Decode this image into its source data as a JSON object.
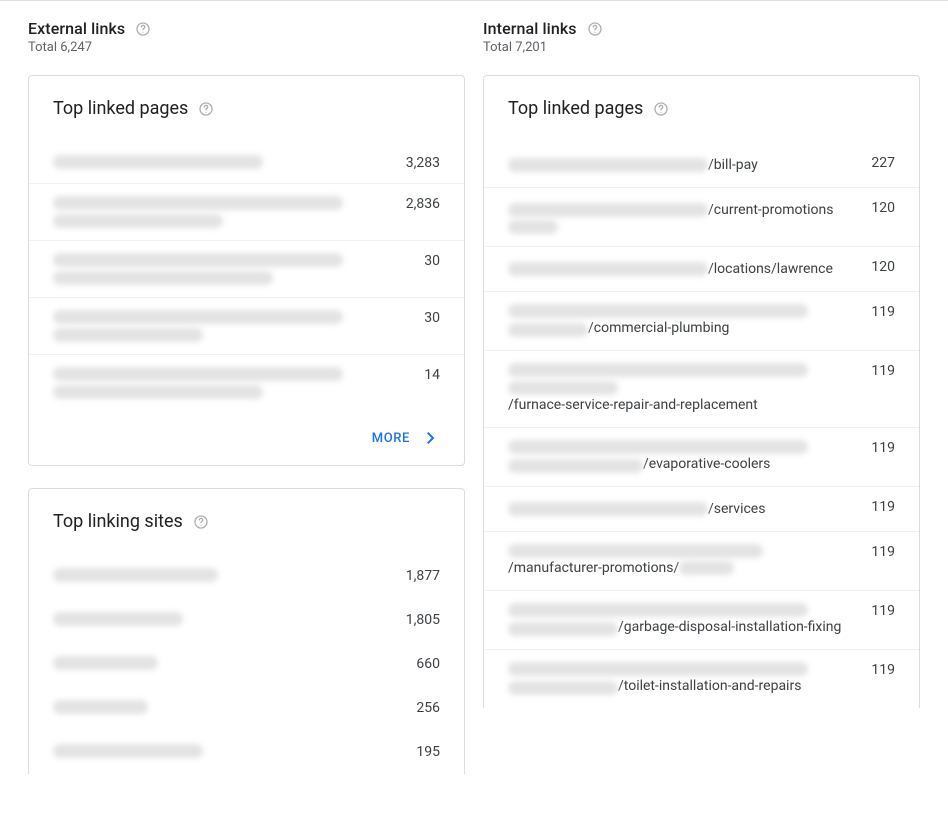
{
  "external": {
    "title": "External links",
    "subtitle": "Total 6,247",
    "top_pages": {
      "title": "Top linked pages",
      "more_label": "MORE",
      "rows": [
        {
          "blurs": [
            210
          ],
          "tail": "",
          "value": "3,283"
        },
        {
          "blurs": [
            290,
            170
          ],
          "tail": "",
          "value": "2,836"
        },
        {
          "blurs": [
            290,
            220
          ],
          "tail": "",
          "value": "30"
        },
        {
          "blurs": [
            290,
            150
          ],
          "tail": "",
          "value": "30"
        },
        {
          "blurs": [
            290,
            210
          ],
          "tail": "",
          "value": "14"
        }
      ]
    },
    "top_sites": {
      "title": "Top linking sites",
      "rows": [
        {
          "blurs": [
            165
          ],
          "tail": "",
          "value": "1,877"
        },
        {
          "blurs": [
            130
          ],
          "tail": "",
          "value": "1,805"
        },
        {
          "blurs": [
            105
          ],
          "tail": "",
          "value": "660"
        },
        {
          "blurs": [
            95
          ],
          "tail": "",
          "value": "256"
        },
        {
          "blurs": [
            150
          ],
          "tail": "",
          "value": "195"
        }
      ]
    }
  },
  "internal": {
    "title": "Internal links",
    "subtitle": "Total 7,201",
    "top_pages": {
      "title": "Top linked pages",
      "rows": [
        {
          "blurs": [
            200
          ],
          "tail": "/bill-pay",
          "value": "227"
        },
        {
          "blurs": [
            200
          ],
          "tail": "/current-promotions ",
          "blurs2": [
            50
          ],
          "value": "120"
        },
        {
          "blurs": [
            200
          ],
          "tail": "/locations/lawrence",
          "value": "120"
        },
        {
          "blurs": [
            300,
            80
          ],
          "tail": "/commercial-plumbing",
          "value": "119"
        },
        {
          "blurs": [
            300,
            110
          ],
          "tail": "/furnace-service-repair-and-replacement",
          "value": "119"
        },
        {
          "blurs": [
            300,
            135
          ],
          "tail": "/evaporative-coolers",
          "value": "119"
        },
        {
          "blurs": [
            200
          ],
          "tail": "/services",
          "value": "119"
        },
        {
          "blurs": [
            255
          ],
          "tail": "/manufacturer-promotions/",
          "blurs2": [
            55
          ],
          "value": "119"
        },
        {
          "blurs": [
            300,
            110
          ],
          "tail": "/garbage-disposal-installation-fixing",
          "value": "119"
        },
        {
          "blurs": [
            300,
            110
          ],
          "tail": "/toilet-installation-and-repairs",
          "value": "119"
        }
      ]
    }
  }
}
